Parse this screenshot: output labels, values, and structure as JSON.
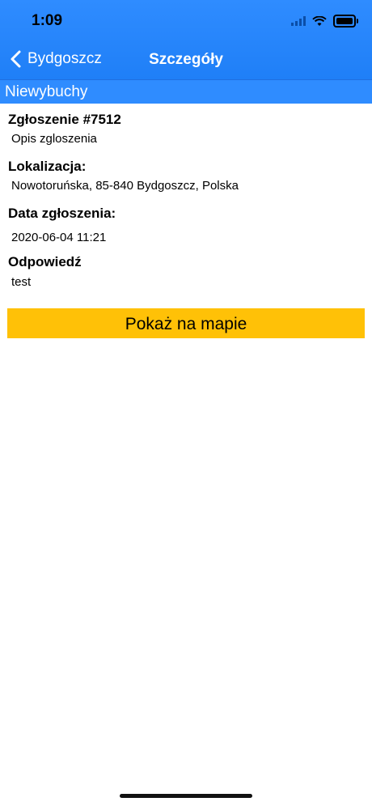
{
  "status_bar": {
    "time": "1:09"
  },
  "nav": {
    "back_label": "Bydgoszcz",
    "title": "Szczegóły"
  },
  "section": {
    "title": "Niewybuchy"
  },
  "details": {
    "report_label": "Zgłoszenie #7512",
    "report_value": "Opis zgloszenia",
    "location_label": "Lokalizacja:",
    "location_value": "Nowotoruńska, 85-840 Bydgoszcz, Polska",
    "date_label": "Data zgłoszenia:",
    "date_value": "2020-06-04 11:21",
    "answer_label": "Odpowiedź",
    "answer_value": "test"
  },
  "actions": {
    "map_button": "Pokaż na mapie"
  },
  "colors": {
    "header": "#2f8cff",
    "button": "#ffc107"
  }
}
